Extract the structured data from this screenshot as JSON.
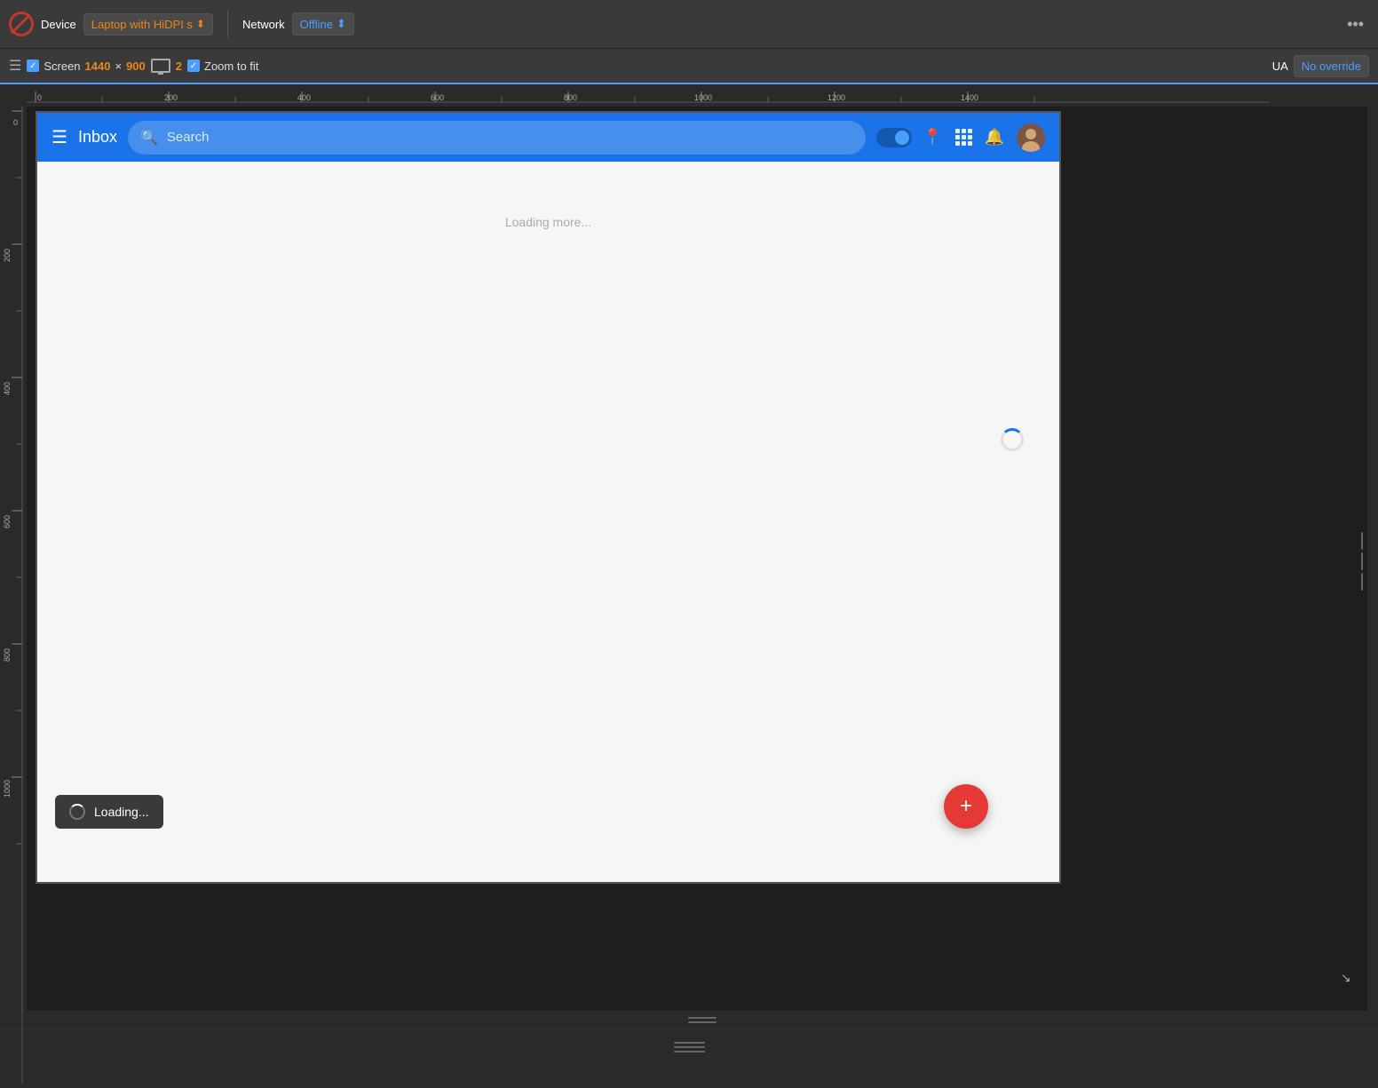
{
  "toolbar": {
    "device_label": "Device",
    "device_value": "Laptop with HiDPI s",
    "network_label": "Network",
    "network_value": "Offline",
    "screen_label": "Screen",
    "screen_width": "1440",
    "screen_height": "900",
    "screen_x": "×",
    "dpr_value": "2",
    "zoom_label": "Zoom to fit",
    "ua_label": "UA",
    "ua_value": "No override",
    "more_icon": "•••"
  },
  "app": {
    "menu_icon": "☰",
    "title": "Inbox",
    "search_placeholder": "Search",
    "loading_text": "Loading more...",
    "fab_icon": "+",
    "toast_label": "Loading..."
  },
  "ruler": {
    "h_ticks": [
      "0",
      "200",
      "400",
      "600",
      "800",
      "1000",
      "1200",
      "1400"
    ],
    "v_ticks": [
      "0",
      "200",
      "400",
      "600",
      "800",
      "1000"
    ]
  }
}
